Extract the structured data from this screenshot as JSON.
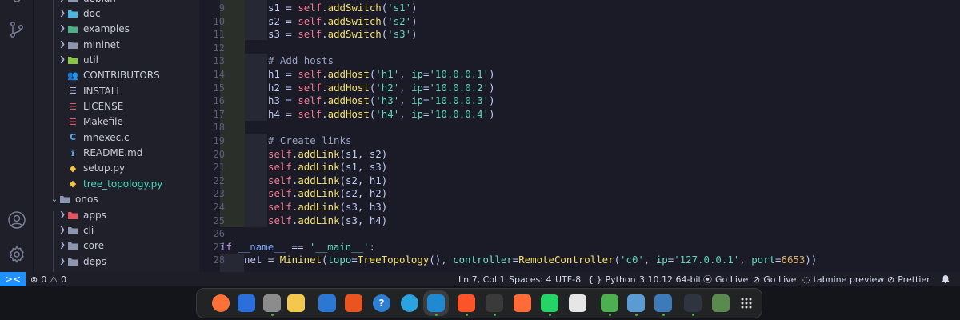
{
  "sidebar": {
    "items": [
      {
        "label": "debian",
        "type": "folder",
        "depth": 1
      },
      {
        "label": "doc",
        "type": "folder",
        "depth": 1
      },
      {
        "label": "examples",
        "type": "folder",
        "depth": 1
      },
      {
        "label": "mininet",
        "type": "folder",
        "depth": 1
      },
      {
        "label": "util",
        "type": "folder",
        "depth": 1
      },
      {
        "label": "CONTRIBUTORS",
        "type": "file",
        "depth": 1
      },
      {
        "label": "INSTALL",
        "type": "file",
        "depth": 1
      },
      {
        "label": "LICENSE",
        "type": "file",
        "depth": 1
      },
      {
        "label": "Makefile",
        "type": "file",
        "depth": 1
      },
      {
        "label": "mnexec.c",
        "type": "file",
        "depth": 1
      },
      {
        "label": "README.md",
        "type": "file",
        "depth": 1
      },
      {
        "label": "setup.py",
        "type": "file",
        "depth": 1
      },
      {
        "label": "tree_topology.py",
        "type": "file",
        "depth": 1
      },
      {
        "label": "onos",
        "type": "folder-open",
        "depth": 0
      },
      {
        "label": "apps",
        "type": "folder",
        "depth": 1
      },
      {
        "label": "cli",
        "type": "folder",
        "depth": 1
      },
      {
        "label": "core",
        "type": "folder",
        "depth": 1
      },
      {
        "label": "deps",
        "type": "folder",
        "depth": 1
      }
    ]
  },
  "editor": {
    "line_numbers": [
      "9",
      "10",
      "11",
      "12",
      "13",
      "14",
      "15",
      "16",
      "17",
      "18",
      "19",
      "20",
      "21",
      "22",
      "23",
      "24",
      "25",
      "26",
      "27",
      "28"
    ],
    "lines": {
      "l9": {
        "lhs": "s1 = ",
        "self": "self",
        "dot": ".",
        "fn": "addSwitch",
        "open": "(",
        "str": "'s1'",
        "close": ")"
      },
      "l10": {
        "lhs": "s2 = ",
        "self": "self",
        "dot": ".",
        "fn": "addSwitch",
        "open": "(",
        "str": "'s2'",
        "close": ")"
      },
      "l11": {
        "lhs": "s3 = ",
        "self": "self",
        "dot": ".",
        "fn": "addSwitch",
        "open": "(",
        "str": "'s3'",
        "close": ")"
      },
      "l13": {
        "comment": "# Add hosts"
      },
      "l14": {
        "lhs": "h1 = ",
        "self": "self",
        "dot": ".",
        "fn": "addHost",
        "open": "(",
        "str": "'h1'",
        "sep": ", ",
        "param": "ip",
        "eq": "=",
        "str2": "'10.0.0.1'",
        "close": ")"
      },
      "l15": {
        "lhs": "h2 = ",
        "self": "self",
        "dot": ".",
        "fn": "addHost",
        "open": "(",
        "str": "'h2'",
        "sep": ", ",
        "param": "ip",
        "eq": "=",
        "str2": "'10.0.0.2'",
        "close": ")"
      },
      "l16": {
        "lhs": "h3 = ",
        "self": "self",
        "dot": ".",
        "fn": "addHost",
        "open": "(",
        "str": "'h3'",
        "sep": ", ",
        "param": "ip",
        "eq": "=",
        "str2": "'10.0.0.3'",
        "close": ")"
      },
      "l17": {
        "lhs": "h4 = ",
        "self": "self",
        "dot": ".",
        "fn": "addHost",
        "open": "(",
        "str": "'h4'",
        "sep": ", ",
        "param": "ip",
        "eq": "=",
        "str2": "'10.0.0.4'",
        "close": ")"
      },
      "l19": {
        "comment": "# Create links"
      },
      "l20": {
        "self": "self",
        "dot": ".",
        "fn": "addLink",
        "args": "(s1, s2)"
      },
      "l21": {
        "self": "self",
        "dot": ".",
        "fn": "addLink",
        "args": "(s1, s3)"
      },
      "l22": {
        "self": "self",
        "dot": ".",
        "fn": "addLink",
        "args": "(s2, h1)"
      },
      "l23": {
        "self": "self",
        "dot": ".",
        "fn": "addLink",
        "args": "(s2, h2)"
      },
      "l24": {
        "self": "self",
        "dot": ".",
        "fn": "addLink",
        "args": "(s3, h3)"
      },
      "l25": {
        "self": "self",
        "dot": ".",
        "fn": "addLink",
        "args": "(s3, h4)"
      },
      "l27": {
        "kw": "if",
        "sp": " ",
        "dunder": "__name__",
        "op": " == ",
        "str": "'__main__'",
        "colon": ":"
      },
      "l28": {
        "lhs": "net = ",
        "fn": "Mininet",
        "open": "(",
        "p1": "topo",
        "eq1": "=",
        "cls": "TreeTopology",
        "call": "()",
        "sep": ", ",
        "p2": "controller",
        "eq2": "=",
        "cls2": "RemoteController",
        "open2": "(",
        "str": "'c0'",
        "sep2": ", ",
        "p3": "ip",
        "eq3": "=",
        "str2": "'127.0.0.1'",
        "sep3": ", ",
        "p4": "port",
        "eq4": "=",
        "num": "6653",
        "close": "))"
      }
    }
  },
  "statusbar": {
    "remote": "><",
    "errors": "0",
    "warnings": "0",
    "position": "Ln 7, Col 1",
    "spaces": "Spaces: 4",
    "encoding": "UTF-8",
    "language_braces": "{ }",
    "language": "Python",
    "interpreter": "3.10.12 64-bit",
    "golive1": "Go Live",
    "golive2": "Go Live",
    "tabnine": "tabnine preview",
    "prettier": "Prettier"
  },
  "dock": {
    "apps": [
      {
        "name": "firefox",
        "label": "",
        "color": "#ff7139"
      },
      {
        "name": "thunderbird",
        "label": "",
        "color": "#2a6fdb"
      },
      {
        "name": "files",
        "label": "",
        "color": "#8c8c8c"
      },
      {
        "name": "rhythmbox",
        "label": "",
        "color": "#f2c94c"
      },
      {
        "name": "writer",
        "label": "",
        "color": "#2b77d2"
      },
      {
        "name": "software",
        "label": "",
        "color": "#e95420"
      },
      {
        "name": "help",
        "label": "?",
        "color": "#2d7fd3"
      },
      {
        "name": "telegram",
        "label": "",
        "color": "#2aa3e0"
      },
      {
        "name": "vscode",
        "label": "",
        "color": "#1f8ad2"
      },
      {
        "name": "brave",
        "label": "",
        "color": "#fb542b"
      },
      {
        "name": "terminal",
        "label": "",
        "color": "#3a3a3a"
      },
      {
        "name": "postman",
        "label": "",
        "color": "#ff6c37"
      },
      {
        "name": "whatsapp",
        "label": "",
        "color": "#25d366"
      },
      {
        "name": "inkscape",
        "label": "",
        "color": "#e6e6e6"
      },
      {
        "name": "onos",
        "label": "",
        "color": "#4caf50"
      },
      {
        "name": "wireshark",
        "label": "",
        "color": "#5a9bd4"
      },
      {
        "name": "monitor",
        "label": "",
        "color": "#3d7ab8"
      },
      {
        "name": "console",
        "label": "",
        "color": "#2e3440"
      },
      {
        "name": "trash",
        "label": "",
        "color": "#5a8a4f"
      },
      {
        "name": "app-grid",
        "label": "",
        "color": "#222325"
      }
    ]
  },
  "colors": {
    "accent": "#1e90ff",
    "self": "#f7768e",
    "function": "#f4e06b",
    "string": "#5fd3bc",
    "keyword": "#bb9af7"
  }
}
